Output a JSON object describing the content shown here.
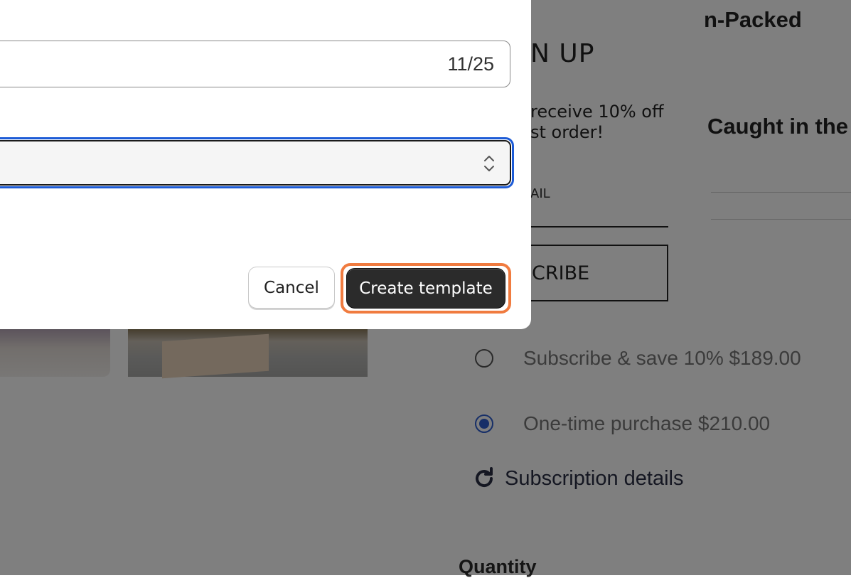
{
  "background": {
    "product_title_fragment_1": "n-Packed",
    "product_title_fragment_2": "Caught in the",
    "popup": {
      "heading": "N UP",
      "offer_line_1": "receive 10% off",
      "offer_line_2": "st order!",
      "email_label": "AIL",
      "subscribe_label": "CRIBE"
    },
    "purchase_options": [
      {
        "label": "Subscribe & save 10% $189.00",
        "checked": false
      },
      {
        "label": "One-time purchase $210.00",
        "checked": true
      }
    ],
    "subscription_details_label": "Subscription details",
    "subscription_icon": "refresh-icon",
    "quantity_label": "Quantity"
  },
  "modal": {
    "name_field": {
      "char_count": "11/25"
    },
    "template_select": {
      "value": "",
      "icon": "select-chevrons-icon"
    },
    "cancel_label": "Cancel",
    "create_label": "Create template"
  },
  "colors": {
    "focus_ring": "#1d5bd6",
    "highlight": "#f07b3f",
    "primary_button": "#2b2b2b",
    "radio_checked": "#2f5fd0"
  }
}
